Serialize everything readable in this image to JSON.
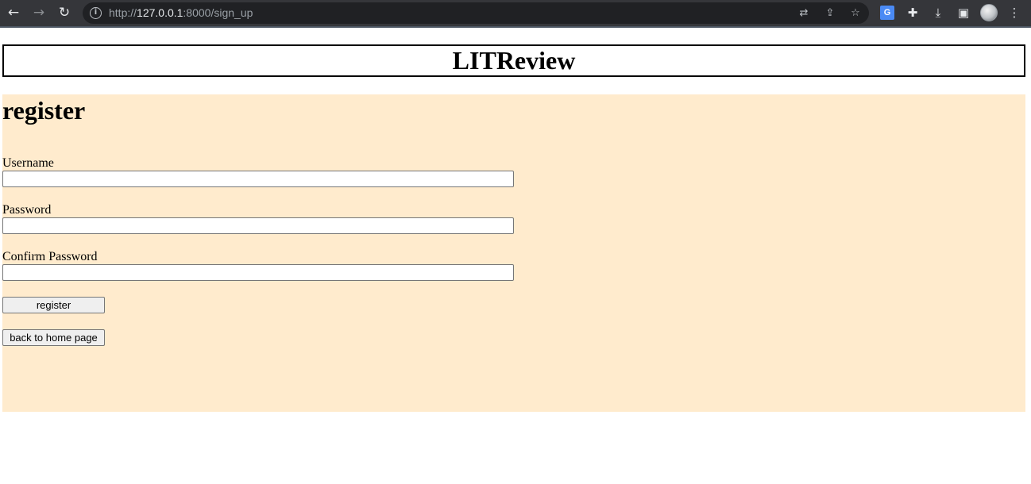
{
  "browser": {
    "url_prefix": "http://",
    "url_host": "127.0.0.1",
    "url_rest": ":8000/sign_up",
    "icons": {
      "back": "←",
      "forward": "→",
      "reload": "↻",
      "info": "i",
      "translate_page": "⇄",
      "share": "⇪",
      "bookmark": "☆",
      "translate_ext": "G",
      "extensions": "✚",
      "download": "⤓",
      "sidepanel": "▣",
      "menu": "⋮"
    }
  },
  "header": {
    "title": "LITReview"
  },
  "form": {
    "heading": "register",
    "username_label": "Username",
    "username_value": "",
    "password_label": "Password",
    "password_value": "",
    "confirm_label": "Confirm Password",
    "confirm_value": "",
    "submit_label": "register",
    "back_label": "back to home page"
  },
  "colors": {
    "content_background": "#ffebcd"
  }
}
